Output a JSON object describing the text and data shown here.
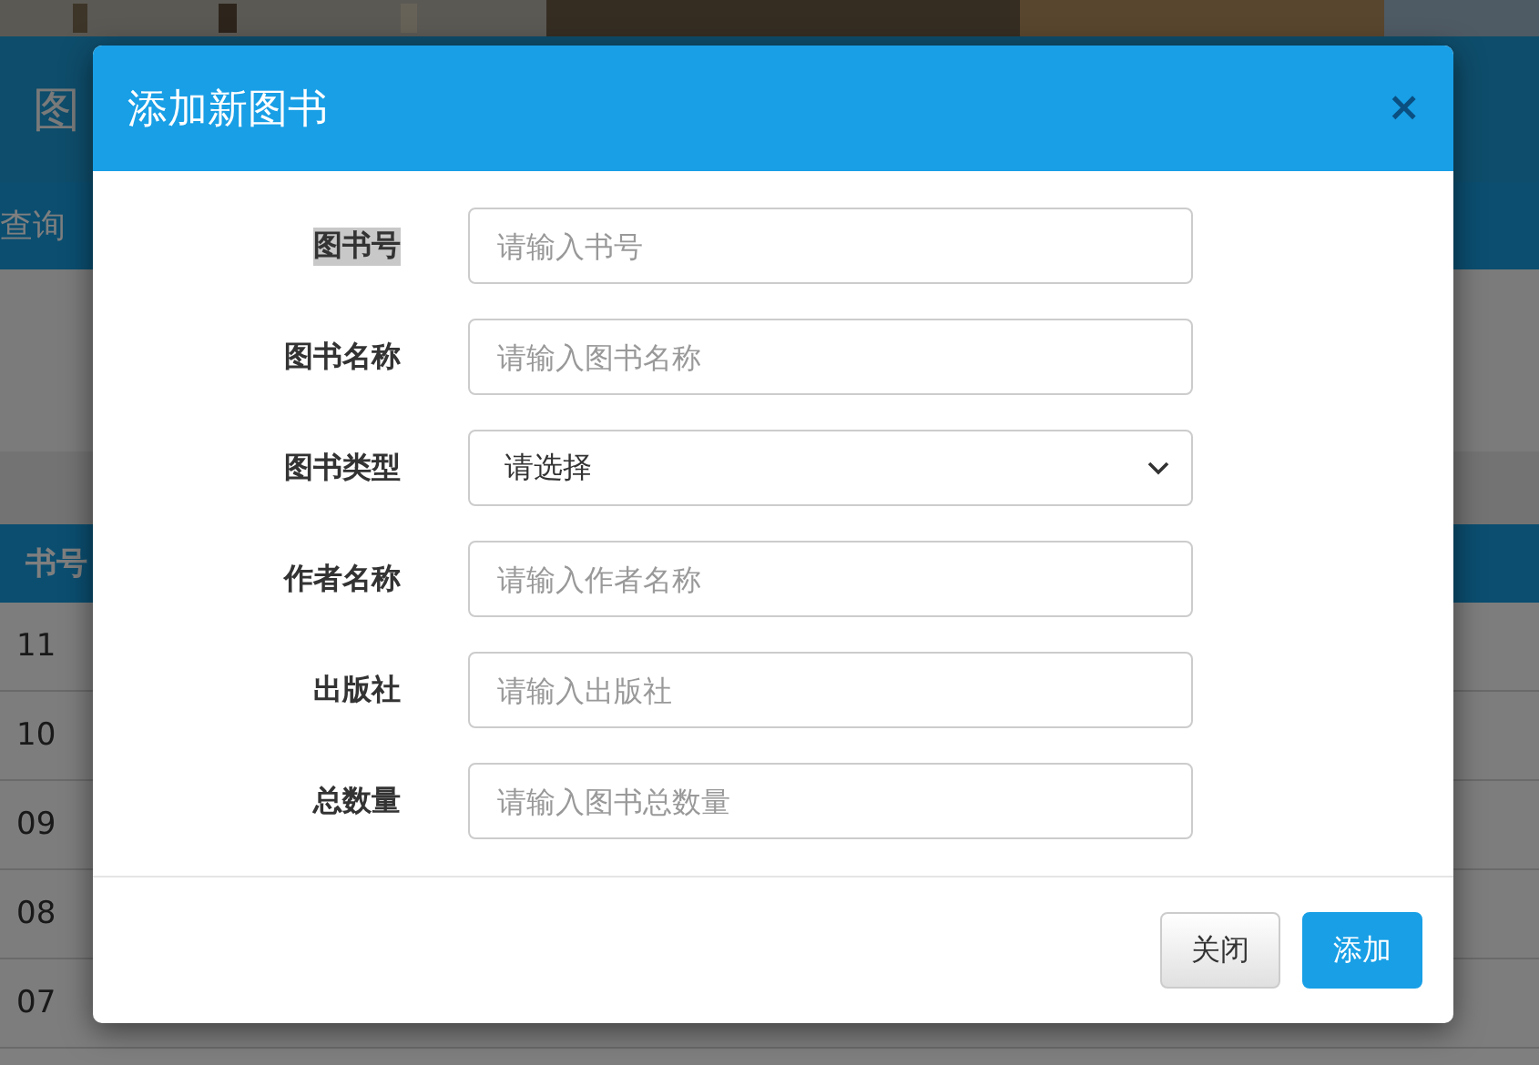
{
  "page": {
    "header_title": "图",
    "query_bar": "查询",
    "table": {
      "columns": [
        "书号"
      ],
      "rows": [
        "11",
        "10",
        "09",
        "08",
        "07"
      ]
    }
  },
  "dialog": {
    "title": "添加新图书",
    "close": "×",
    "fields": [
      {
        "kind": "text",
        "label": "图书号",
        "placeholder": "请输入书号",
        "highlighted": true
      },
      {
        "kind": "text",
        "label": "图书名称",
        "placeholder": "请输入图书名称",
        "highlighted": false
      },
      {
        "kind": "select",
        "label": "图书类型",
        "value": "请选择",
        "highlighted": false
      },
      {
        "kind": "text",
        "label": "作者名称",
        "placeholder": "请输入作者名称",
        "highlighted": false
      },
      {
        "kind": "text",
        "label": "出版社",
        "placeholder": "请输入出版社",
        "highlighted": false
      },
      {
        "kind": "text",
        "label": "总数量",
        "placeholder": "请输入图书总数量",
        "highlighted": false
      }
    ],
    "buttons": [
      {
        "kind": "default",
        "label": "关闭"
      },
      {
        "kind": "primary",
        "label": "添加"
      }
    ]
  }
}
